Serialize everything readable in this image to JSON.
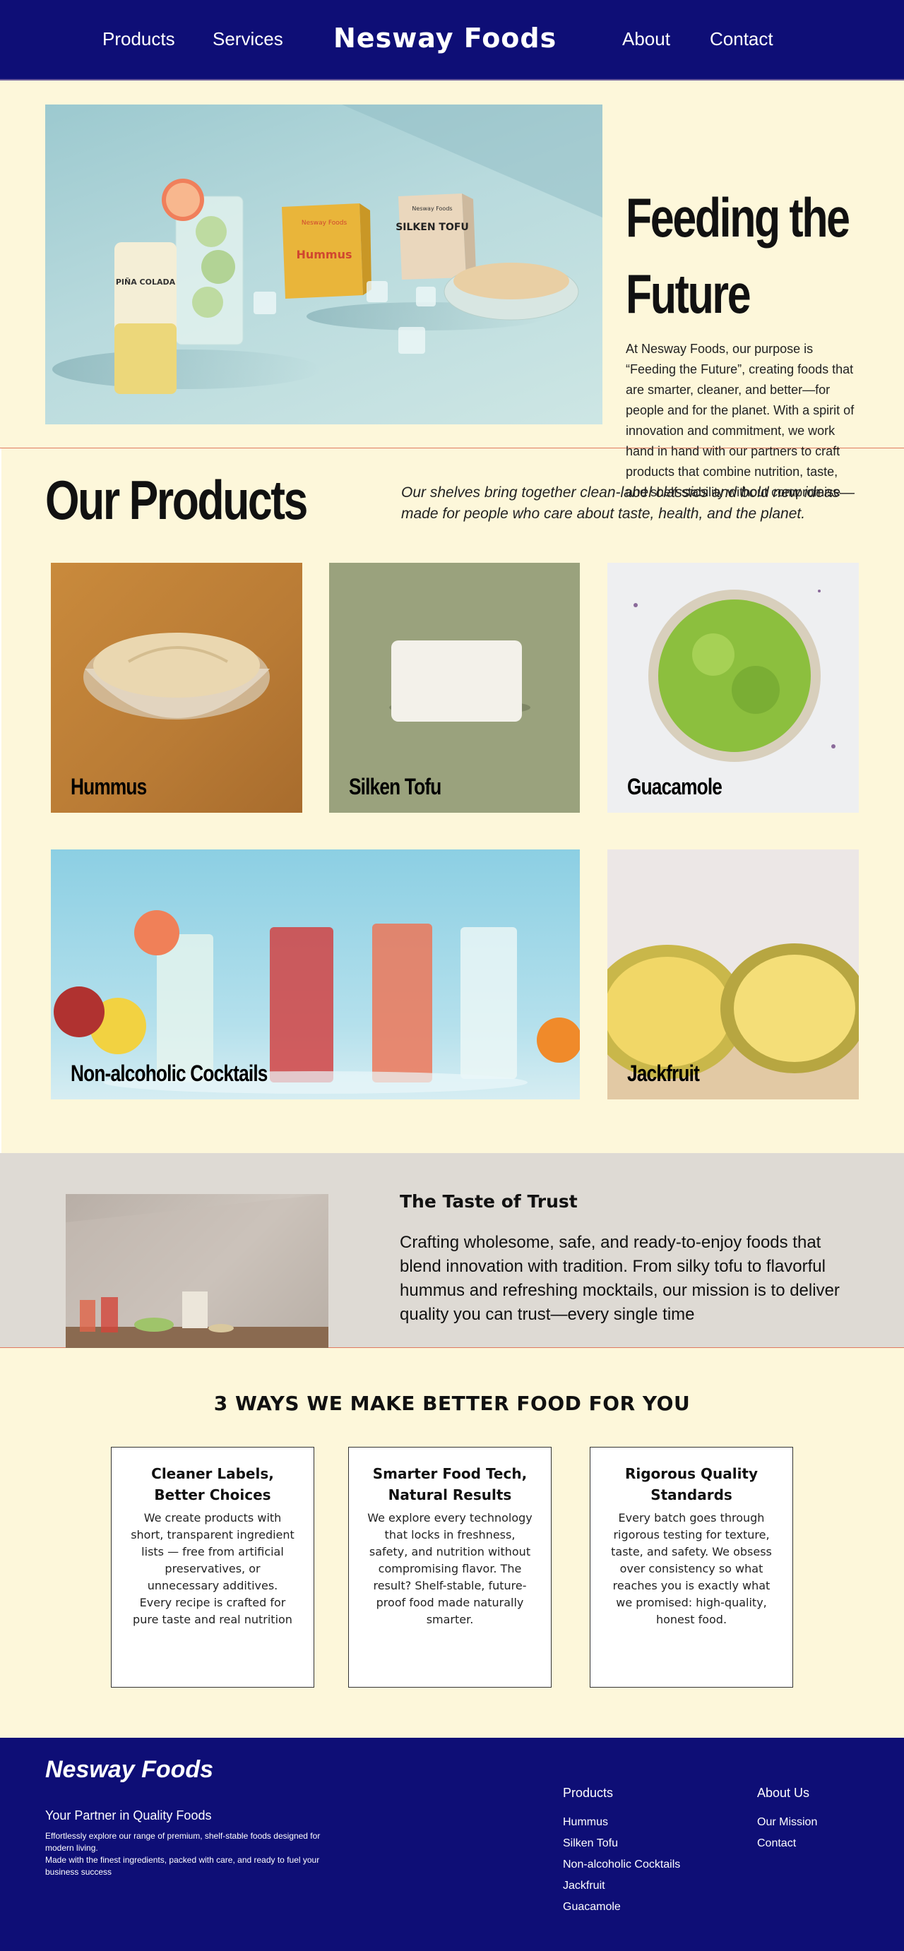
{
  "nav": {
    "products": "Products",
    "services": "Services",
    "logo": "Nesway Foods",
    "about": "About",
    "contact": "Contact"
  },
  "hero": {
    "title_line1": "Feeding the",
    "title_line2": "Future",
    "text": "At Nesway Foods, our purpose is “Feeding the Future”, creating foods that are smarter, cleaner, and better—for people and for the planet. With a spirit of innovation and commitment, we work hand in hand with our partners to craft products that combine nutrition, taste, and shelf-stability without compromise",
    "pkg_hummus": "Hummus",
    "pkg_brand": "Nesway Foods",
    "pkg_tofu": "SILKEN TOFU",
    "can_label": "PIÑA COLADA"
  },
  "products": {
    "title": "Our Products",
    "tagline": "Our shelves bring together clean-label classics and bold new ideas—made for people who care about taste, health, and the planet.",
    "items": [
      {
        "label": "Hummus"
      },
      {
        "label": "Silken Tofu"
      },
      {
        "label": "Guacamole"
      },
      {
        "label": "Non-alcoholic Cocktails"
      },
      {
        "label": "Jackfruit"
      }
    ]
  },
  "trust": {
    "title": "The Taste of Trust",
    "text": "Crafting wholesome, safe, and ready-to-enjoy foods that blend innovation with tradition. From silky tofu to flavorful hummus and refreshing mocktails, our mission is to deliver quality you can trust—every single time"
  },
  "ways": {
    "title": "3 WAYS WE MAKE BETTER FOOD FOR YOU",
    "cards": [
      {
        "title": "Cleaner Labels, Better Choices",
        "text": "We create products with short, transparent ingredient lists — free from artificial preservatives, or unnecessary additives. Every recipe is crafted for pure taste and real nutrition"
      },
      {
        "title": "Smarter Food Tech, Natural Results",
        "text": "We explore every technology that locks in freshness, safety, and nutrition without compromising flavor. The result? Shelf-stable, future-proof food made naturally smarter."
      },
      {
        "title": "Rigorous Quality Standards",
        "text": "Every batch goes through rigorous testing for texture, taste, and safety. We obsess over consistency so what reaches you is exactly what we promised: high-quality, honest food."
      }
    ]
  },
  "footer": {
    "logo": "Nesway Foods",
    "tagline": "Your Partner in Quality Foods",
    "desc1": "Effortlessly explore our range of premium, shelf-stable foods designed for modern living.",
    "desc2": "Made with the finest ingredients, packed with care, and ready to fuel your business success",
    "products_heading": "Products",
    "products_links": [
      "Hummus",
      "Silken Tofu",
      "Non-alcoholic Cocktails",
      "Jackfruit",
      "Guacamole"
    ],
    "about_heading": "About Us",
    "about_links": [
      "Our Mission",
      "Contact"
    ]
  },
  "colors": {
    "navy": "#0e0e76",
    "cream": "#fdf7da",
    "accent_line": "#e07a5f",
    "trust_bg": "#dedad4"
  }
}
